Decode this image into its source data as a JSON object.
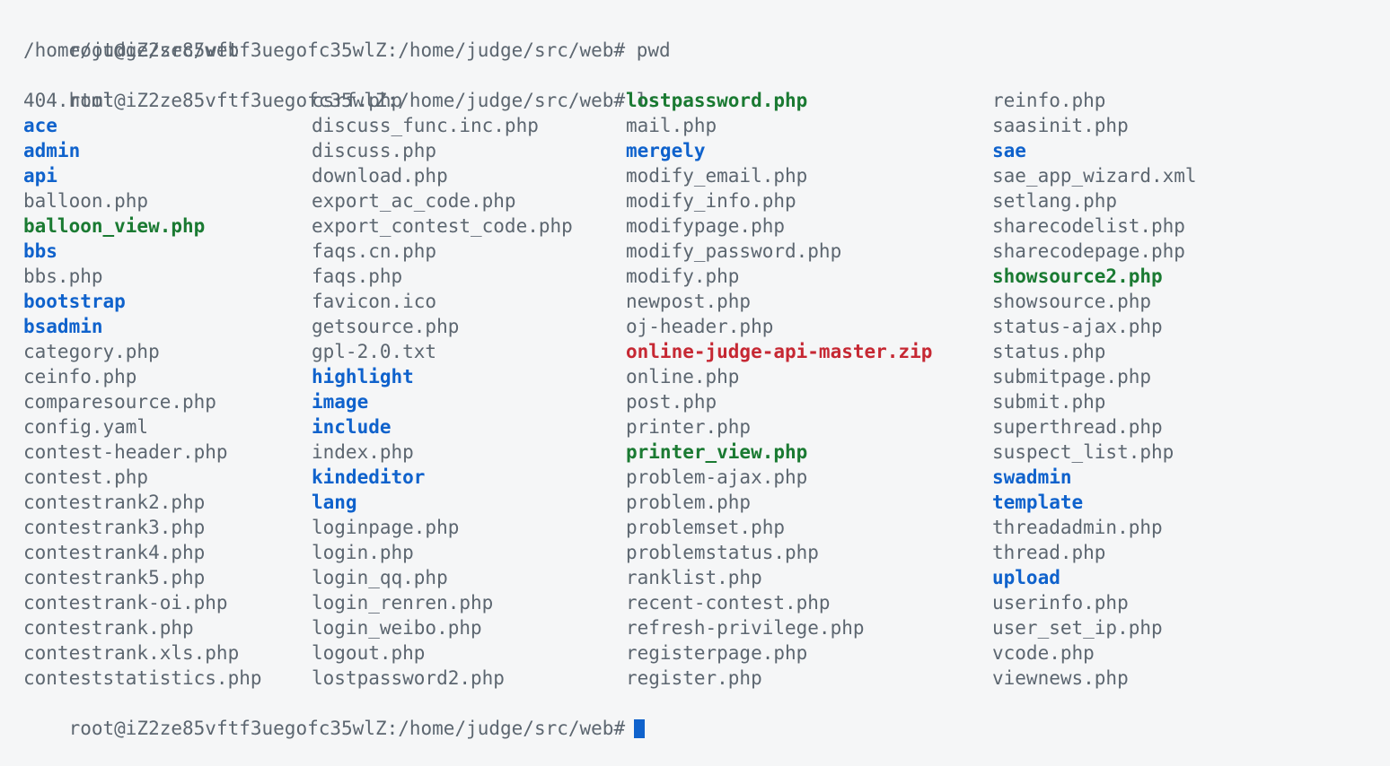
{
  "terminal": {
    "prompt": "root@iZ2ze85vftf3uegofc35wlZ:/home/judge/src/web#",
    "user_host": "root@iZ2ze85vftf3uegofc35wlZ",
    "cwd": "/home/judge/src/web",
    "background_color": "#f5f6f7",
    "cursor_color": "#0f62cc",
    "colors": {
      "file": "#5c6670",
      "directory": "#0f62cc",
      "executable": "#1a7a32",
      "archive": "#c62833"
    },
    "history": [
      {
        "type": "prompt",
        "command": "pwd"
      },
      {
        "type": "output",
        "text": "/home/judge/src/web"
      },
      {
        "type": "prompt",
        "command": "ls"
      }
    ],
    "final_prompt": {
      "text": "root@iZ2ze85vftf3uegofc35wlZ:/home/judge/src/web#",
      "cursor": "block"
    }
  },
  "listing": {
    "command": "ls",
    "column_count": 4,
    "row_count": 24,
    "columns": [
      [
        {
          "name": "404.html",
          "kind": "file"
        },
        {
          "name": "ace",
          "kind": "directory"
        },
        {
          "name": "admin",
          "kind": "directory"
        },
        {
          "name": "api",
          "kind": "directory"
        },
        {
          "name": "balloon.php",
          "kind": "file"
        },
        {
          "name": "balloon_view.php",
          "kind": "executable"
        },
        {
          "name": "bbs",
          "kind": "directory"
        },
        {
          "name": "bbs.php",
          "kind": "file"
        },
        {
          "name": "bootstrap",
          "kind": "directory"
        },
        {
          "name": "bsadmin",
          "kind": "directory"
        },
        {
          "name": "category.php",
          "kind": "file"
        },
        {
          "name": "ceinfo.php",
          "kind": "file"
        },
        {
          "name": "comparesource.php",
          "kind": "file"
        },
        {
          "name": "config.yaml",
          "kind": "file"
        },
        {
          "name": "contest-header.php",
          "kind": "file"
        },
        {
          "name": "contest.php",
          "kind": "file"
        },
        {
          "name": "contestrank2.php",
          "kind": "file"
        },
        {
          "name": "contestrank3.php",
          "kind": "file"
        },
        {
          "name": "contestrank4.php",
          "kind": "file"
        },
        {
          "name": "contestrank5.php",
          "kind": "file"
        },
        {
          "name": "contestrank-oi.php",
          "kind": "file"
        },
        {
          "name": "contestrank.php",
          "kind": "file"
        },
        {
          "name": "contestrank.xls.php",
          "kind": "file"
        },
        {
          "name": "conteststatistics.php",
          "kind": "file"
        }
      ],
      [
        {
          "name": "csrf.php",
          "kind": "file"
        },
        {
          "name": "discuss_func.inc.php",
          "kind": "file"
        },
        {
          "name": "discuss.php",
          "kind": "file"
        },
        {
          "name": "download.php",
          "kind": "file"
        },
        {
          "name": "export_ac_code.php",
          "kind": "file"
        },
        {
          "name": "export_contest_code.php",
          "kind": "file"
        },
        {
          "name": "faqs.cn.php",
          "kind": "file"
        },
        {
          "name": "faqs.php",
          "kind": "file"
        },
        {
          "name": "favicon.ico",
          "kind": "file"
        },
        {
          "name": "getsource.php",
          "kind": "file"
        },
        {
          "name": "gpl-2.0.txt",
          "kind": "file"
        },
        {
          "name": "highlight",
          "kind": "directory"
        },
        {
          "name": "image",
          "kind": "directory"
        },
        {
          "name": "include",
          "kind": "directory"
        },
        {
          "name": "index.php",
          "kind": "file"
        },
        {
          "name": "kindeditor",
          "kind": "directory"
        },
        {
          "name": "lang",
          "kind": "directory"
        },
        {
          "name": "loginpage.php",
          "kind": "file"
        },
        {
          "name": "login.php",
          "kind": "file"
        },
        {
          "name": "login_qq.php",
          "kind": "file"
        },
        {
          "name": "login_renren.php",
          "kind": "file"
        },
        {
          "name": "login_weibo.php",
          "kind": "file"
        },
        {
          "name": "logout.php",
          "kind": "file"
        },
        {
          "name": "lostpassword2.php",
          "kind": "file"
        }
      ],
      [
        {
          "name": "lostpassword.php",
          "kind": "executable"
        },
        {
          "name": "mail.php",
          "kind": "file"
        },
        {
          "name": "mergely",
          "kind": "directory"
        },
        {
          "name": "modify_email.php",
          "kind": "file"
        },
        {
          "name": "modify_info.php",
          "kind": "file"
        },
        {
          "name": "modifypage.php",
          "kind": "file"
        },
        {
          "name": "modify_password.php",
          "kind": "file"
        },
        {
          "name": "modify.php",
          "kind": "file"
        },
        {
          "name": "newpost.php",
          "kind": "file"
        },
        {
          "name": "oj-header.php",
          "kind": "file"
        },
        {
          "name": "online-judge-api-master.zip",
          "kind": "archive"
        },
        {
          "name": "online.php",
          "kind": "file"
        },
        {
          "name": "post.php",
          "kind": "file"
        },
        {
          "name": "printer.php",
          "kind": "file"
        },
        {
          "name": "printer_view.php",
          "kind": "executable"
        },
        {
          "name": "problem-ajax.php",
          "kind": "file"
        },
        {
          "name": "problem.php",
          "kind": "file"
        },
        {
          "name": "problemset.php",
          "kind": "file"
        },
        {
          "name": "problemstatus.php",
          "kind": "file"
        },
        {
          "name": "ranklist.php",
          "kind": "file"
        },
        {
          "name": "recent-contest.php",
          "kind": "file"
        },
        {
          "name": "refresh-privilege.php",
          "kind": "file"
        },
        {
          "name": "registerpage.php",
          "kind": "file"
        },
        {
          "name": "register.php",
          "kind": "file"
        }
      ],
      [
        {
          "name": "reinfo.php",
          "kind": "file"
        },
        {
          "name": "saasinit.php",
          "kind": "file"
        },
        {
          "name": "sae",
          "kind": "directory"
        },
        {
          "name": "sae_app_wizard.xml",
          "kind": "file"
        },
        {
          "name": "setlang.php",
          "kind": "file"
        },
        {
          "name": "sharecodelist.php",
          "kind": "file"
        },
        {
          "name": "sharecodepage.php",
          "kind": "file"
        },
        {
          "name": "showsource2.php",
          "kind": "executable"
        },
        {
          "name": "showsource.php",
          "kind": "file"
        },
        {
          "name": "status-ajax.php",
          "kind": "file"
        },
        {
          "name": "status.php",
          "kind": "file"
        },
        {
          "name": "submitpage.php",
          "kind": "file"
        },
        {
          "name": "submit.php",
          "kind": "file"
        },
        {
          "name": "superthread.php",
          "kind": "file"
        },
        {
          "name": "suspect_list.php",
          "kind": "file"
        },
        {
          "name": "swadmin",
          "kind": "directory"
        },
        {
          "name": "template",
          "kind": "directory"
        },
        {
          "name": "threadadmin.php",
          "kind": "file"
        },
        {
          "name": "thread.php",
          "kind": "file"
        },
        {
          "name": "upload",
          "kind": "directory"
        },
        {
          "name": "userinfo.php",
          "kind": "file"
        },
        {
          "name": "user_set_ip.php",
          "kind": "file"
        },
        {
          "name": "vcode.php",
          "kind": "file"
        },
        {
          "name": "viewnews.php",
          "kind": "file"
        }
      ]
    ]
  }
}
